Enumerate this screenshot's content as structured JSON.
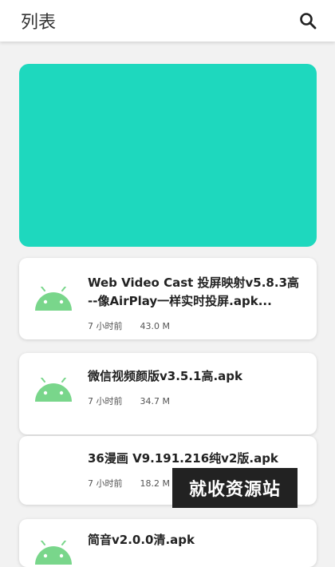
{
  "appbar": {
    "title": "列表",
    "search_icon": "search-icon"
  },
  "banner": {
    "color": "#1ed8be"
  },
  "items": [
    {
      "name": "Web Video Cast 投屏映射v5.8.3高 --像AirPlay一样实时投屏.apk...",
      "time": "7 小时前",
      "size": "43.0 M",
      "icon": "android-icon"
    },
    {
      "name": "微信视频颜版v3.5.1高.apk",
      "time": "7 小时前",
      "size": "34.7 M",
      "icon": "android-icon"
    },
    {
      "name": "36漫画 V9.191.216纯v2版.apk",
      "time": "7 小时前",
      "size": "18.2 M",
      "icon": "none"
    },
    {
      "name": "简音v2.0.0清.apk",
      "icon": "android-icon"
    }
  ],
  "watermark": {
    "text": "就收资源站"
  }
}
